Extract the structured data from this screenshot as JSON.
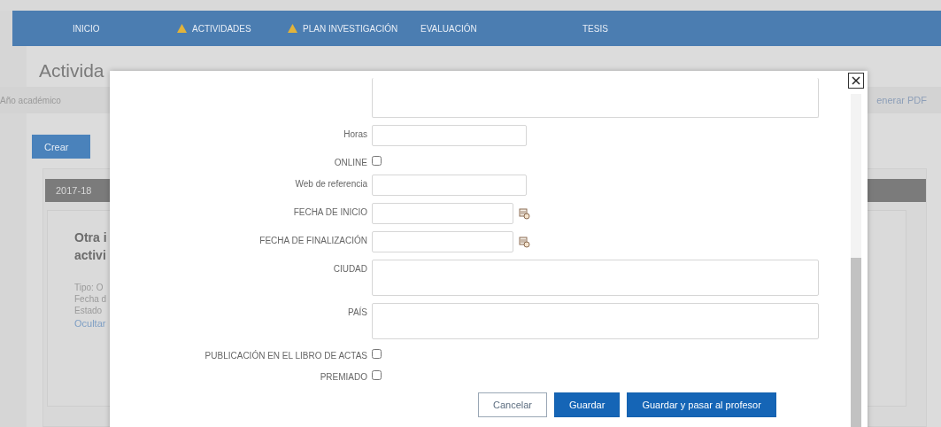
{
  "nav": {
    "items": [
      {
        "label": "INICIO",
        "warning": false
      },
      {
        "label": "ACTIVIDADES",
        "warning": true
      },
      {
        "label": "PLAN INVESTIGACIÓN",
        "warning": true
      },
      {
        "label": "EVALUACIÓN",
        "warning": false
      },
      {
        "label": "TESIS",
        "warning": false
      }
    ]
  },
  "background": {
    "title": "Activida",
    "filter_label": "Año académico",
    "pdf_link": "enerar PDF",
    "create_button": "Crear",
    "year": "2017-18",
    "card": {
      "title_lines": [
        "Otra i",
        "activi"
      ],
      "details": [
        "Tipo: O",
        "Fecha d",
        "Estado"
      ],
      "link": "Ocultar"
    }
  },
  "modal": {
    "fields": [
      {
        "kind": "textarea"
      },
      {
        "kind": "text",
        "label": "Horas"
      },
      {
        "kind": "checkbox",
        "label": "ONLINE",
        "checked": false
      },
      {
        "kind": "text",
        "label": "Web de referencia"
      },
      {
        "kind": "date",
        "label": "FECHA DE INICIO"
      },
      {
        "kind": "date",
        "label": "FECHA DE FINALIZACIÓN"
      },
      {
        "kind": "textarea",
        "label": "CIUDAD"
      },
      {
        "kind": "textarea",
        "label": "PAÍS"
      },
      {
        "kind": "checkbox",
        "label": "PUBLICACIÓN EN EL LIBRO DE ACTAS",
        "checked": false
      },
      {
        "kind": "checkbox",
        "label": "PREMIADO",
        "checked": false
      }
    ],
    "buttons": [
      {
        "label": "Cancelar",
        "kind": "secondary"
      },
      {
        "label": "Guardar",
        "kind": "primary"
      },
      {
        "label": "Guardar y pasar al profesor",
        "kind": "primary"
      }
    ]
  }
}
